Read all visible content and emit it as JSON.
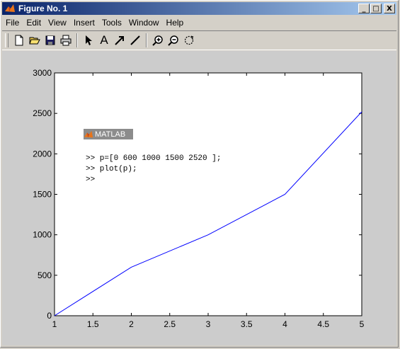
{
  "window": {
    "title": "Figure No. 1",
    "controls": {
      "minimize": "_",
      "maximize": "□",
      "close": "X"
    }
  },
  "menu": [
    "File",
    "Edit",
    "View",
    "Insert",
    "Tools",
    "Window",
    "Help"
  ],
  "toolbar": {
    "buttons": [
      {
        "icon": "new-file-icon"
      },
      {
        "icon": "open-folder-icon"
      },
      {
        "icon": "save-icon"
      },
      {
        "icon": "print-icon"
      },
      {
        "icon": "select-arrow-icon"
      },
      {
        "icon": "insert-text-icon",
        "glyph": "A"
      },
      {
        "icon": "insert-arrow-icon"
      },
      {
        "icon": "insert-line-icon"
      },
      {
        "icon": "zoom-in-icon"
      },
      {
        "icon": "zoom-out-icon"
      },
      {
        "icon": "rotate-3d-icon"
      }
    ]
  },
  "badge": {
    "label": "MATLAB"
  },
  "command_lines": [
    ">> p=[0 600 1000 1500 2520 ];",
    ">> plot(p);",
    ">>"
  ],
  "colors": {
    "line": "#0000ff",
    "figure_bg": "#cccccc",
    "axes_bg": "#ffffff",
    "title_bar_start": "#0a246a",
    "title_bar_end": "#a6caf0"
  },
  "chart_data": {
    "type": "line",
    "title": "",
    "xlabel": "",
    "ylabel": "",
    "series": [
      {
        "x": [
          1,
          2,
          3,
          4,
          5
        ],
        "values": [
          0,
          600,
          1000,
          1500,
          2520
        ]
      }
    ],
    "xlim": [
      1,
      5
    ],
    "ylim": [
      0,
      3000
    ],
    "xticks": [
      1,
      1.5,
      2,
      2.5,
      3,
      3.5,
      4,
      4.5,
      5
    ],
    "xtick_labels": [
      "1",
      "1.5",
      "2",
      "2.5",
      "3",
      "3.5",
      "4",
      "4.5",
      "5"
    ],
    "yticks": [
      0,
      500,
      1000,
      1500,
      2000,
      2500,
      3000
    ],
    "ytick_labels": [
      "0",
      "500",
      "1000",
      "1500",
      "2000",
      "2500",
      "3000"
    ],
    "grid": false
  }
}
